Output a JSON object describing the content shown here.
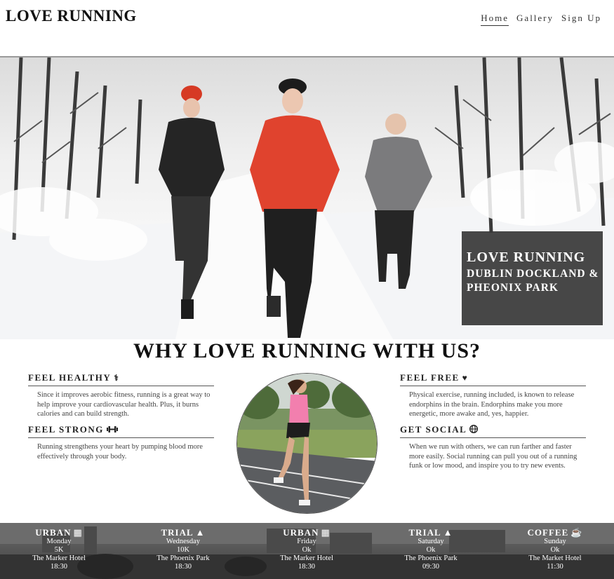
{
  "header": {
    "logo": "LOVE RUNNING",
    "nav": [
      {
        "label": "Home",
        "active": true
      },
      {
        "label": "Gallery",
        "active": false
      },
      {
        "label": "Sign Up",
        "active": false
      }
    ]
  },
  "hero": {
    "title": "LOVE RUNNING",
    "subtitle_line1": "DUBLIN DOCKLAND &",
    "subtitle_line2": "PHEONIX PARK"
  },
  "why": {
    "title": "WHY LOVE RUNNING WITH US?",
    "features": [
      {
        "title": "FEEL HEALTHY",
        "icon": "medical-icon",
        "text": "Since it improves aerobic fitness, running is a great way to help improve your cardiovascular health. Plus, it burns calories and can build strength."
      },
      {
        "title": "FEEL STRONG",
        "icon": "dumbbell-icon",
        "text": "Running strengthens your heart by pumping blood more effectively through your body."
      },
      {
        "title": "FEEL FREE",
        "icon": "heart-icon",
        "text": "Physical exercise, running included, is known to release endorphins in the brain. Endorphins make you more energetic, more awake and, yes, happier."
      },
      {
        "title": "GET SOCIAL",
        "icon": "globe-icon",
        "text": "When we run with others, we can run farther and faster more easily. Social running can pull you out of a running funk or low mood, and inspire you to try new events."
      }
    ]
  },
  "events": [
    {
      "title": "URBAN",
      "icon": "building-icon",
      "day": "Monday",
      "distance": "5K",
      "location": "The Marker Hotel",
      "time": "18:30"
    },
    {
      "title": "TRIAL",
      "icon": "tree-icon",
      "day": "Wednesday",
      "distance": "10K",
      "location": "The Phoenix Park",
      "time": "18:30"
    },
    {
      "title": "URBAN",
      "icon": "building-icon",
      "day": "Friday",
      "distance": "Ok",
      "location": "The Marker Hotel",
      "time": "18:30"
    },
    {
      "title": "TRIAL",
      "icon": "tree-icon",
      "day": "Saturday",
      "distance": "Ok",
      "location": "The Phoenix Park",
      "time": "09:30"
    },
    {
      "title": "COFFEE",
      "icon": "coffee-icon",
      "day": "Sunday",
      "distance": "Ok",
      "location": "The Market Hotel",
      "time": "11:30"
    }
  ]
}
